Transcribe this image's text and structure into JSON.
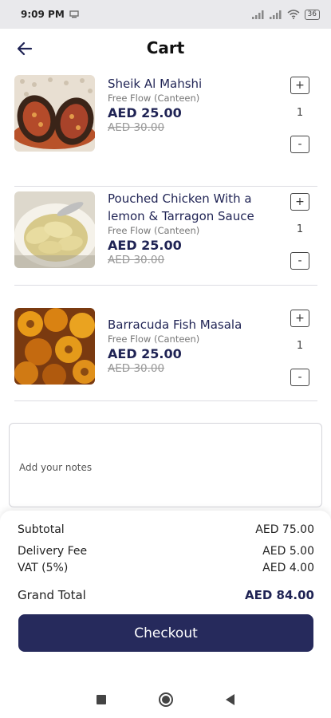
{
  "status": {
    "time": "9:09 PM",
    "battery": "36"
  },
  "header": {
    "title": "Cart"
  },
  "items": [
    {
      "name": "Sheik Al Mahshi",
      "flow": "Free Flow (Canteen)",
      "price": "AED 25.00",
      "old_price": "AED 30.00",
      "quantity": "1"
    },
    {
      "name": "Pouched Chicken With a lemon & Tarragon Sauce",
      "flow": "Free Flow (Canteen)",
      "price": "AED 25.00",
      "old_price": "AED 30.00",
      "quantity": "1"
    },
    {
      "name": "Barracuda Fish Masala",
      "flow": "Free Flow (Canteen)",
      "price": "AED 25.00",
      "old_price": "AED 30.00",
      "quantity": "1"
    }
  ],
  "qty_controls": {
    "plus": "+",
    "minus": "-"
  },
  "notes": {
    "placeholder": "Add your notes"
  },
  "summary": {
    "subtotal_label": "Subtotal",
    "subtotal_value": "AED 75.00",
    "delivery_label": "Delivery Fee",
    "delivery_value": "AED 5.00",
    "vat_label": "VAT (5%)",
    "vat_value": "AED 4.00",
    "total_label": "Grand Total",
    "total_value": "AED 84.00"
  },
  "checkout_label": "Checkout",
  "colors": {
    "primary": "#262a5c",
    "text_dark": "#1f2354"
  }
}
